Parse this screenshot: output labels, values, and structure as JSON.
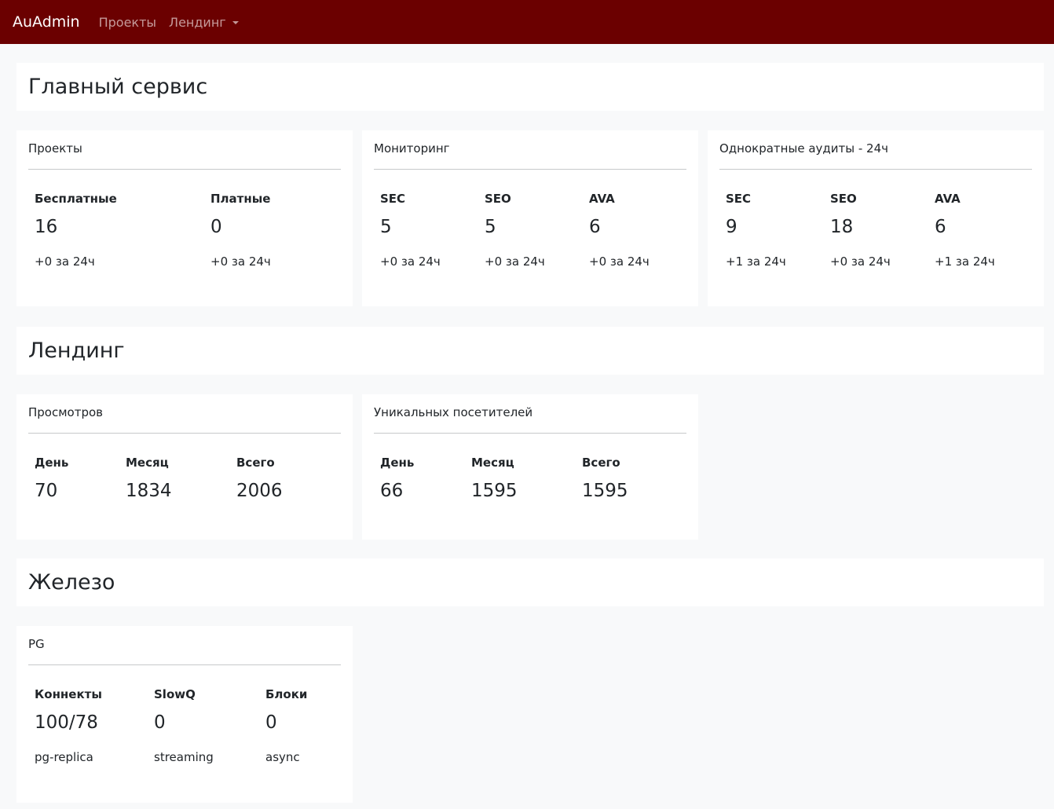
{
  "navbar": {
    "brand": "AuAdmin",
    "links": [
      {
        "label": "Проекты"
      },
      {
        "label": "Лендинг",
        "dropdown": true
      }
    ],
    "background": "#6b0000"
  },
  "sections": {
    "main": {
      "title": "Главный сервис",
      "cards": {
        "projects": {
          "title": "Проекты",
          "stats": [
            {
              "label": "Бесплатные",
              "value": "16",
              "delta": "+0 за 24ч"
            },
            {
              "label": "Платные",
              "value": "0",
              "delta": "+0 за 24ч"
            }
          ]
        },
        "monitoring": {
          "title": "Мониторинг",
          "stats": [
            {
              "label": "SEC",
              "value": "5",
              "delta": "+0 за 24ч"
            },
            {
              "label": "SEO",
              "value": "5",
              "delta": "+0 за 24ч"
            },
            {
              "label": "AVA",
              "value": "6",
              "delta": "+0 за 24ч"
            }
          ]
        },
        "audits": {
          "title": "Однократные аудиты - 24ч",
          "stats": [
            {
              "label": "SEC",
              "value": "9",
              "delta": "+1 за 24ч"
            },
            {
              "label": "SEO",
              "value": "18",
              "delta": "+0 за 24ч"
            },
            {
              "label": "AVA",
              "value": "6",
              "delta": "+1 за 24ч"
            }
          ]
        }
      }
    },
    "landing": {
      "title": "Лендинг",
      "cards": {
        "views": {
          "title": "Просмотров",
          "stats": [
            {
              "label": "День",
              "value": "70"
            },
            {
              "label": "Месяц",
              "value": "1834"
            },
            {
              "label": "Всего",
              "value": "2006"
            }
          ]
        },
        "visitors": {
          "title": "Уникальных посетителей",
          "stats": [
            {
              "label": "День",
              "value": "66"
            },
            {
              "label": "Месяц",
              "value": "1595"
            },
            {
              "label": "Всего",
              "value": "1595"
            }
          ]
        }
      }
    },
    "hardware": {
      "title": "Железо",
      "cards": {
        "pg": {
          "title": "PG",
          "stats": [
            {
              "label": "Коннекты",
              "value": "100/78",
              "delta": "pg-replica"
            },
            {
              "label": "SlowQ",
              "value": "0",
              "delta": "streaming"
            },
            {
              "label": "Блоки",
              "value": "0",
              "delta": "async"
            }
          ]
        }
      }
    }
  }
}
